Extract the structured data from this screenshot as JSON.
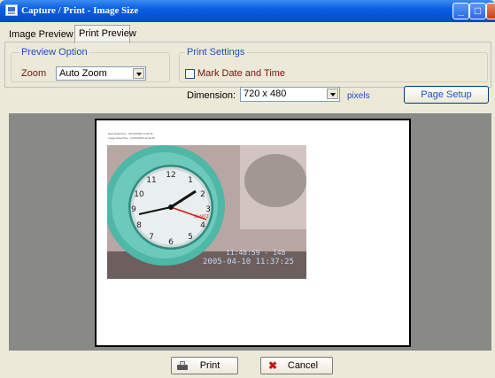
{
  "window": {
    "title": "Capture / Print - Image Size"
  },
  "tabs": [
    {
      "label": "Image Preview"
    },
    {
      "label": "Print Preview"
    }
  ],
  "preview_option": {
    "group_title": "Preview Option",
    "zoom_label": "Zoom",
    "zoom_value": "Auto Zoom"
  },
  "print_settings": {
    "group_title": "Print Settings",
    "mark_date_label": "Mark Date and Time",
    "mark_date_checked": false,
    "dimension_label": "Dimension:",
    "dimension_value": "720 x 480",
    "units": "pixels",
    "page_setup_label": "Page Setup"
  },
  "preview_page": {
    "header_line1": "Raw Data/Time : 04/10/2005 11:04:25",
    "header_line2": "Image Date/Time : 04/10/2005 11:04:25",
    "photo_overlay_line1": "11:48:59 - 148",
    "photo_overlay_line2": "2005-04-10 11:37:25"
  },
  "footer": {
    "print_label": "Print",
    "cancel_label": "Cancel"
  },
  "colors": {
    "title_bar": "#0a5fe3",
    "accent_label": "#7a1010",
    "group_title": "#1f4fbf",
    "preview_background": "#898987"
  }
}
